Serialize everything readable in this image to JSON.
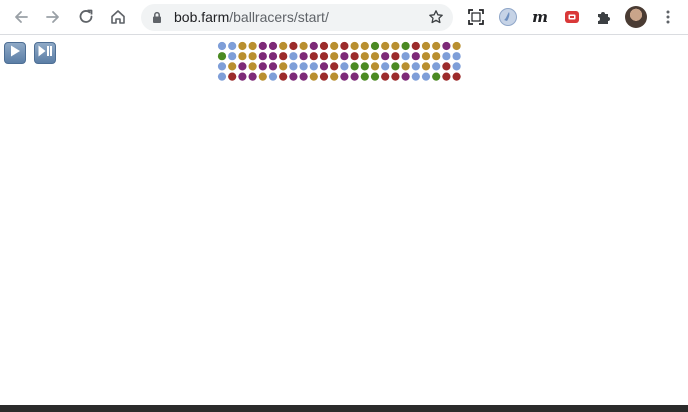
{
  "browser": {
    "url_host": "bob.farm",
    "url_path": "/ballracers/start/",
    "icons": {
      "back": "arrow-left-icon",
      "forward": "arrow-right-icon",
      "reload": "reload-icon",
      "home": "home-icon",
      "lock": "lock-icon",
      "bookmark": "star-icon",
      "screenshot": "screen-capture-icon",
      "extensions": "puzzle-icon",
      "menu": "kebab-menu-icon"
    }
  },
  "game": {
    "controls": {
      "play_icon": "play-icon",
      "step_icon": "play-pause-icon"
    },
    "ball_colors": {
      "B": "#7e9ed8",
      "G": "#b98f2f",
      "P": "#7d2a78",
      "R": "#9c2b2b",
      "N": "#4b8a22"
    },
    "ball_grid": [
      "BBGGPPGRGPRGRGGNGGNRGGPG",
      "NBGGPPRBPRRGPRGGPRBPGGBB",
      "BGPGPPGBBBPRBNNGBNGBGBRB",
      "BRPPGBRPPGRGPPNNRRPBBNRR"
    ]
  }
}
